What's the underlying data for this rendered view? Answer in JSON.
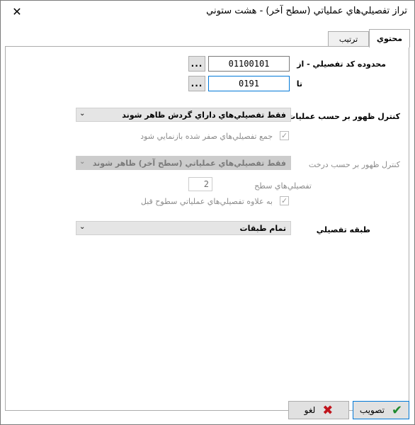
{
  "window": {
    "title": "تراز تفصيلي‌هاي عملياتي (سطح آخر) - هشت ستوني",
    "close_icon": "close-icon"
  },
  "tabs": [
    {
      "label": "محتوي",
      "active": true
    },
    {
      "label": "ترتيب",
      "active": false
    }
  ],
  "range": {
    "from_label": "محدوده کد تفصيلي - از",
    "from_value": "01100101",
    "to_label": "تا",
    "to_value": "0191",
    "browse_label": "..."
  },
  "control_by_ops": {
    "label": "کنترل ظهور بر حسب عمليات",
    "selected": "فقط تفصيلي‌هاي داراي گردش ظاهر شوند"
  },
  "hide_zero_checkbox": {
    "label": "جمع تفصيلي‌هاي صفر شده بازنمايي شود",
    "checked": true,
    "enabled": false
  },
  "control_by_tree": {
    "label": "کنترل ظهور بر حسب درخت",
    "selected": "فقط تفصيلي‌هاي عملياتي (سطح آخر) ظاهر شوند",
    "enabled": false
  },
  "level": {
    "label": "تفصيلي‌هاي سطح",
    "value": "2"
  },
  "prev_levels_checkbox": {
    "label": "به علاوه تفصيلي‌هاي عملياتي سطوح قبل",
    "checked": true,
    "enabled": false
  },
  "category": {
    "label": "طبقه تفصيلي",
    "selected": "تمام طبقات"
  },
  "buttons": {
    "approve_label": "تصويب",
    "cancel_label": "لغو"
  }
}
